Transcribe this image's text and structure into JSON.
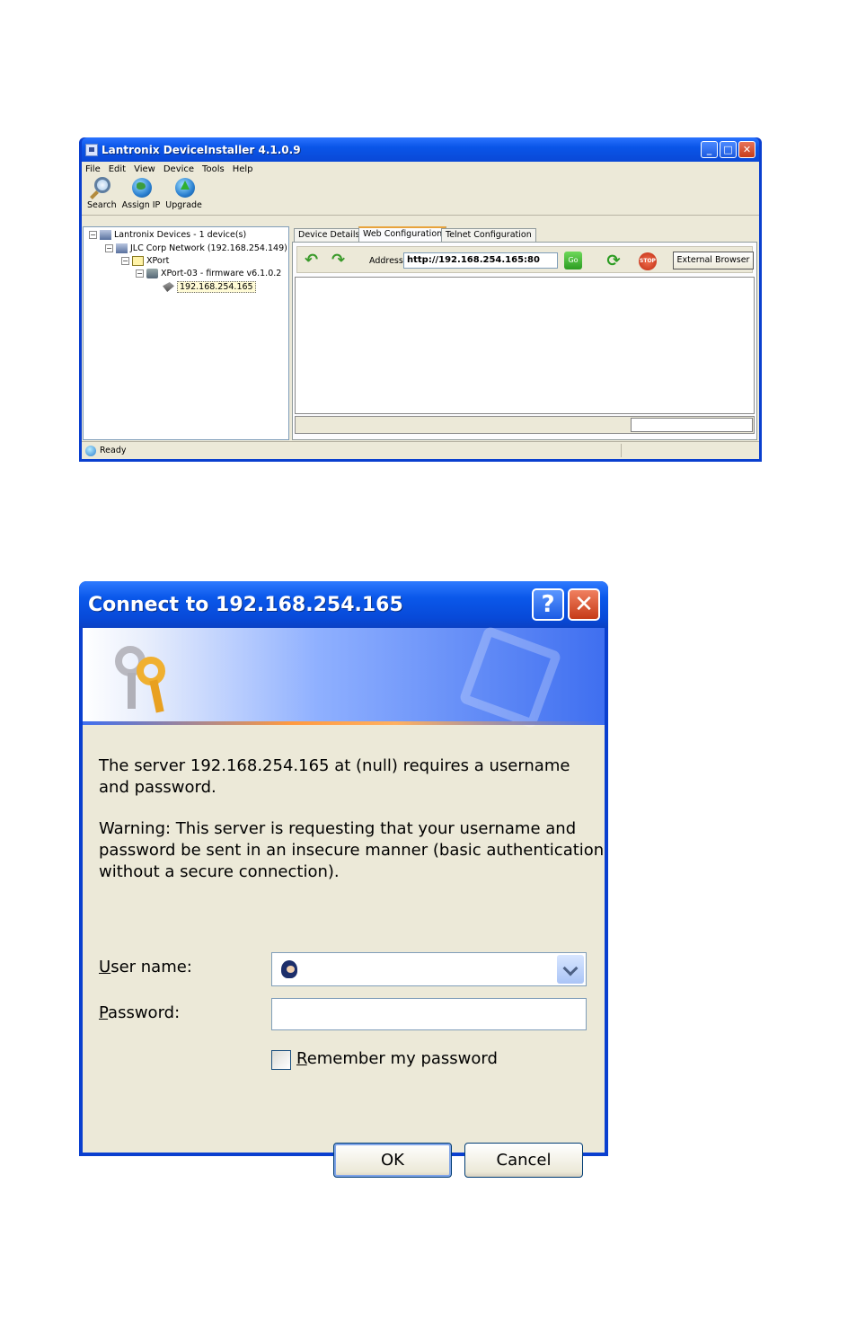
{
  "deviceinstaller": {
    "title": "Lantronix DeviceInstaller 4.1.0.9",
    "menu": [
      "File",
      "Edit",
      "View",
      "Device",
      "Tools",
      "Help"
    ],
    "toolbar": {
      "search_label": "Search",
      "assign_ip_label": "Assign IP",
      "upgrade_label": "Upgrade"
    },
    "tree": {
      "root": "Lantronix Devices - 1 device(s)",
      "network": "JLC Corp Network (192.168.254.149)",
      "folder": "XPort",
      "device": "XPort-03 - firmware v6.1.0.2",
      "ip": "192.168.254.165"
    },
    "tabs": [
      "Device Details",
      "Web Configuration",
      "Telnet Configuration"
    ],
    "active_tab": "Web Configuration",
    "address_label": "Address",
    "address_value": "http://192.168.254.165:80",
    "go_label": "Go",
    "stop_label": "STOP",
    "external_browser_label": "External Browser",
    "status": "Ready"
  },
  "dialog": {
    "title": "Connect to 192.168.254.165",
    "message1_line1": "The server 192.168.254.165 at (null) requires a username",
    "message1_line2": "and password.",
    "warning_line1": "Warning: This server is requesting that your username and",
    "warning_line2": "password be sent in an insecure manner (basic authentication",
    "warning_line3": "without a secure connection).",
    "username_label_first": "U",
    "username_label_rest": "ser name:",
    "password_label_first": "P",
    "password_label_rest": "assword:",
    "username_value": "",
    "password_value": "",
    "remember_first": "R",
    "remember_rest": "emember my password",
    "remember_checked": false,
    "ok_label": "OK",
    "cancel_label": "Cancel"
  },
  "colors": {
    "xp_title_blue": "#0a55e8",
    "face": "#ece9d8",
    "close_red": "#c63c1a"
  }
}
